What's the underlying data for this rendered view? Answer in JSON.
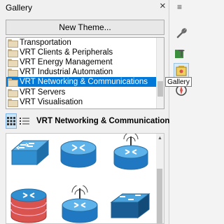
{
  "panel": {
    "title": "Gallery",
    "close_icon": "close-icon"
  },
  "new_theme_button": {
    "label": "New Theme..."
  },
  "themes": {
    "items": [
      {
        "label": "Transportation",
        "selected": false
      },
      {
        "label": "VRT Clients & Peripherals",
        "selected": false
      },
      {
        "label": "VRT Energy Management",
        "selected": false
      },
      {
        "label": "VRT Industrial Automation",
        "selected": false
      },
      {
        "label": "VRT Networking & Communications",
        "selected": true
      },
      {
        "label": "VRT Servers",
        "selected": false
      },
      {
        "label": "VRT Visualisation",
        "selected": false
      }
    ]
  },
  "toolbar": {
    "icon_view": "grid-icon",
    "list_view": "list-icon",
    "category_title": "VRT Networking & Communications"
  },
  "gallery": {
    "shapes": [
      "switch",
      "router",
      "wireless-router",
      "firewall",
      "wireless-router",
      "switch-dark"
    ]
  },
  "sidebar": {
    "menu_icon": "menu-icon",
    "buttons": [
      "wrench-icon",
      "text-style-icon",
      "gallery-icon",
      "navigator-icon"
    ],
    "tooltip": "Gallery"
  },
  "colors": {
    "selection": "#0078d7",
    "shape_blue": "#2f8fd0",
    "firewall_red": "#d9534f"
  }
}
